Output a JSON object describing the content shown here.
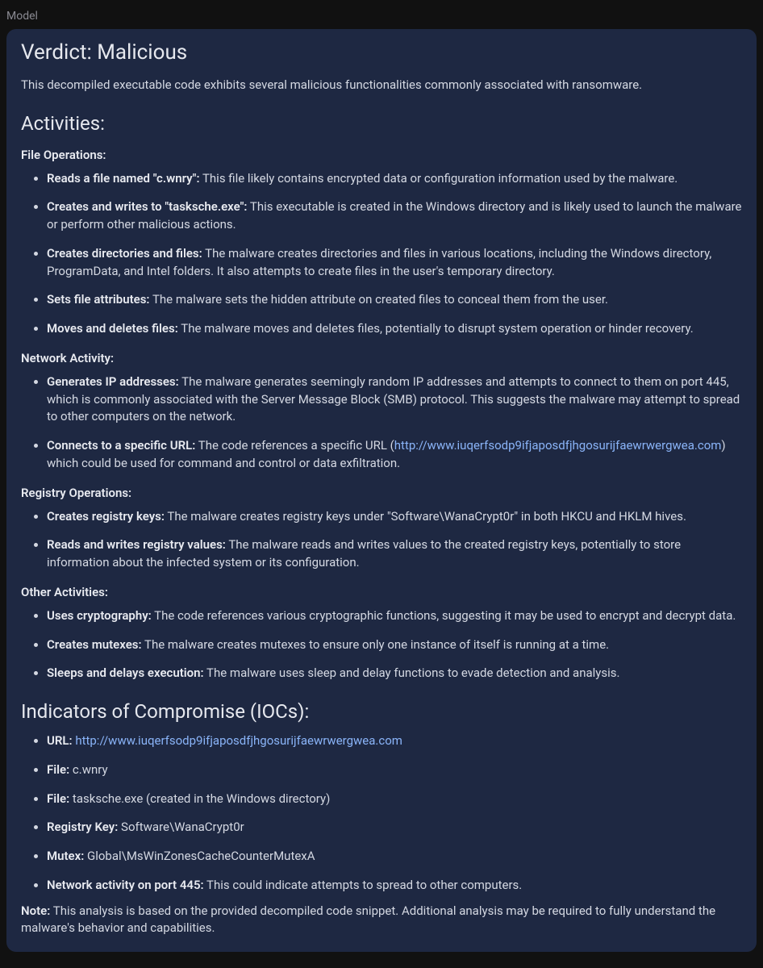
{
  "role": "Model",
  "verdict": {
    "heading": "Verdict: Malicious",
    "intro": "This decompiled executable code exhibits several malicious functionalities commonly associated with ransomware."
  },
  "activities": {
    "heading": "Activities:",
    "fileOps": {
      "heading": "File Operations:",
      "items": [
        {
          "label": "Reads a file named \"c.wnry\":",
          "text": " This file likely contains encrypted data or configuration information used by the malware."
        },
        {
          "label": "Creates and writes to \"tasksche.exe\":",
          "text": " This executable is created in the Windows directory and is likely used to launch the malware or perform other malicious actions."
        },
        {
          "label": "Creates directories and files:",
          "text": " The malware creates directories and files in various locations, including the Windows directory, ProgramData, and Intel folders. It also attempts to create files in the user's temporary directory."
        },
        {
          "label": "Sets file attributes:",
          "text": " The malware sets the hidden attribute on created files to conceal them from the user."
        },
        {
          "label": "Moves and deletes files:",
          "text": " The malware moves and deletes files, potentially to disrupt system operation or hinder recovery."
        }
      ]
    },
    "network": {
      "heading": "Network Activity:",
      "items": [
        {
          "label": "Generates IP addresses:",
          "text": " The malware generates seemingly random IP addresses and attempts to connect to them on port 445, which is commonly associated with the Server Message Block (SMB) protocol. This suggests the malware may attempt to spread to other computers on the network."
        },
        {
          "label": "Connects to a specific URL:",
          "pre": " The code references a specific URL (",
          "url": "http://www.iuqerfsodp9ifjaposdfjhgosurijfaewrwergwea.com",
          "post": ") which could be used for command and control or data exfiltration."
        }
      ]
    },
    "registry": {
      "heading": "Registry Operations:",
      "items": [
        {
          "label": "Creates registry keys:",
          "text": " The malware creates registry keys under \"Software\\WanaCrypt0r\" in both HKCU and HKLM hives."
        },
        {
          "label": "Reads and writes registry values:",
          "text": " The malware reads and writes values to the created registry keys, potentially to store information about the infected system or its configuration."
        }
      ]
    },
    "other": {
      "heading": "Other Activities:",
      "items": [
        {
          "label": "Uses cryptography:",
          "text": " The code references various cryptographic functions, suggesting it may be used to encrypt and decrypt data."
        },
        {
          "label": "Creates mutexes:",
          "text": " The malware creates mutexes to ensure only one instance of itself is running at a time."
        },
        {
          "label": "Sleeps and delays execution:",
          "text": " The malware uses sleep and delay functions to evade detection and analysis."
        }
      ]
    }
  },
  "iocs": {
    "heading": "Indicators of Compromise (IOCs):",
    "items": [
      {
        "label": "URL:",
        "link": "http://www.iuqerfsodp9ifjaposdfjhgosurijfaewrwergwea.com"
      },
      {
        "label": "File:",
        "text": " c.wnry"
      },
      {
        "label": "File:",
        "text": " tasksche.exe (created in the Windows directory)"
      },
      {
        "label": "Registry Key:",
        "text": " Software\\WanaCrypt0r"
      },
      {
        "label": "Mutex:",
        "text": " Global\\MsWinZonesCacheCounterMutexA"
      },
      {
        "label": "Network activity on port 445:",
        "text": " This could indicate attempts to spread to other computers."
      }
    ]
  },
  "note": {
    "label": "Note:",
    "text": " This analysis is based on the provided decompiled code snippet. Additional analysis may be required to fully understand the malware's behavior and capabilities."
  }
}
